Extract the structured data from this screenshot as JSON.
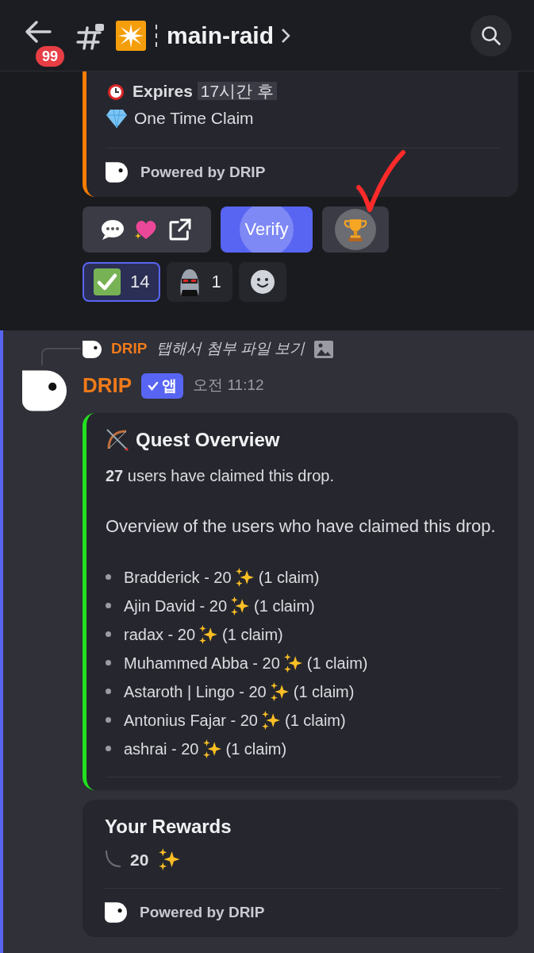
{
  "header": {
    "badge": "99",
    "channel": "main-raid"
  },
  "prev_embed": {
    "color": "#f57c00",
    "lines": [
      {
        "kind": "expires",
        "label": "Expires",
        "value": "17시간 후"
      },
      {
        "kind": "claim",
        "text": "One Time Claim"
      }
    ],
    "footer": "Powered by DRIP"
  },
  "buttons": [
    {
      "kind": "link"
    },
    {
      "kind": "primary",
      "label": "Verify"
    },
    {
      "kind": "trophy"
    }
  ],
  "reactions": [
    {
      "kind": "check",
      "count": "14",
      "selected": true
    },
    {
      "kind": "robot",
      "count": "1",
      "selected": false
    },
    {
      "kind": "add"
    }
  ],
  "reply": {
    "author": "DRIP",
    "text": "탭해서 첨부 파일 보기"
  },
  "message": {
    "author": "DRIP",
    "badge": "앱",
    "time": "오전 11:12"
  },
  "quest": {
    "color": "#22e01f",
    "title": "Quest Overview",
    "summary": "**27** users have claimed this drop.",
    "description": "Overview of the users who have claimed this drop.",
    "items": [
      {
        "name": "Bradderick - 20",
        "claims": "(1 claim)"
      },
      {
        "name": "Ajin David - 20",
        "claims": "(1 claim)"
      },
      {
        "name": "radax - 20",
        "claims": "(1 claim)"
      },
      {
        "name": "Muhammed Abba - 20",
        "claims": "(1 claim)"
      },
      {
        "name": "Astaroth | Lingo - 20",
        "claims": "(1 claim)"
      },
      {
        "name": "Antonius Fajar - 20",
        "claims": "(1 claim)"
      },
      {
        "name": "ashrai - 20",
        "claims": "(1 claim)"
      }
    ]
  },
  "rewards": {
    "title": "Your Rewards",
    "amount": "20",
    "footer": "Powered by DRIP"
  }
}
